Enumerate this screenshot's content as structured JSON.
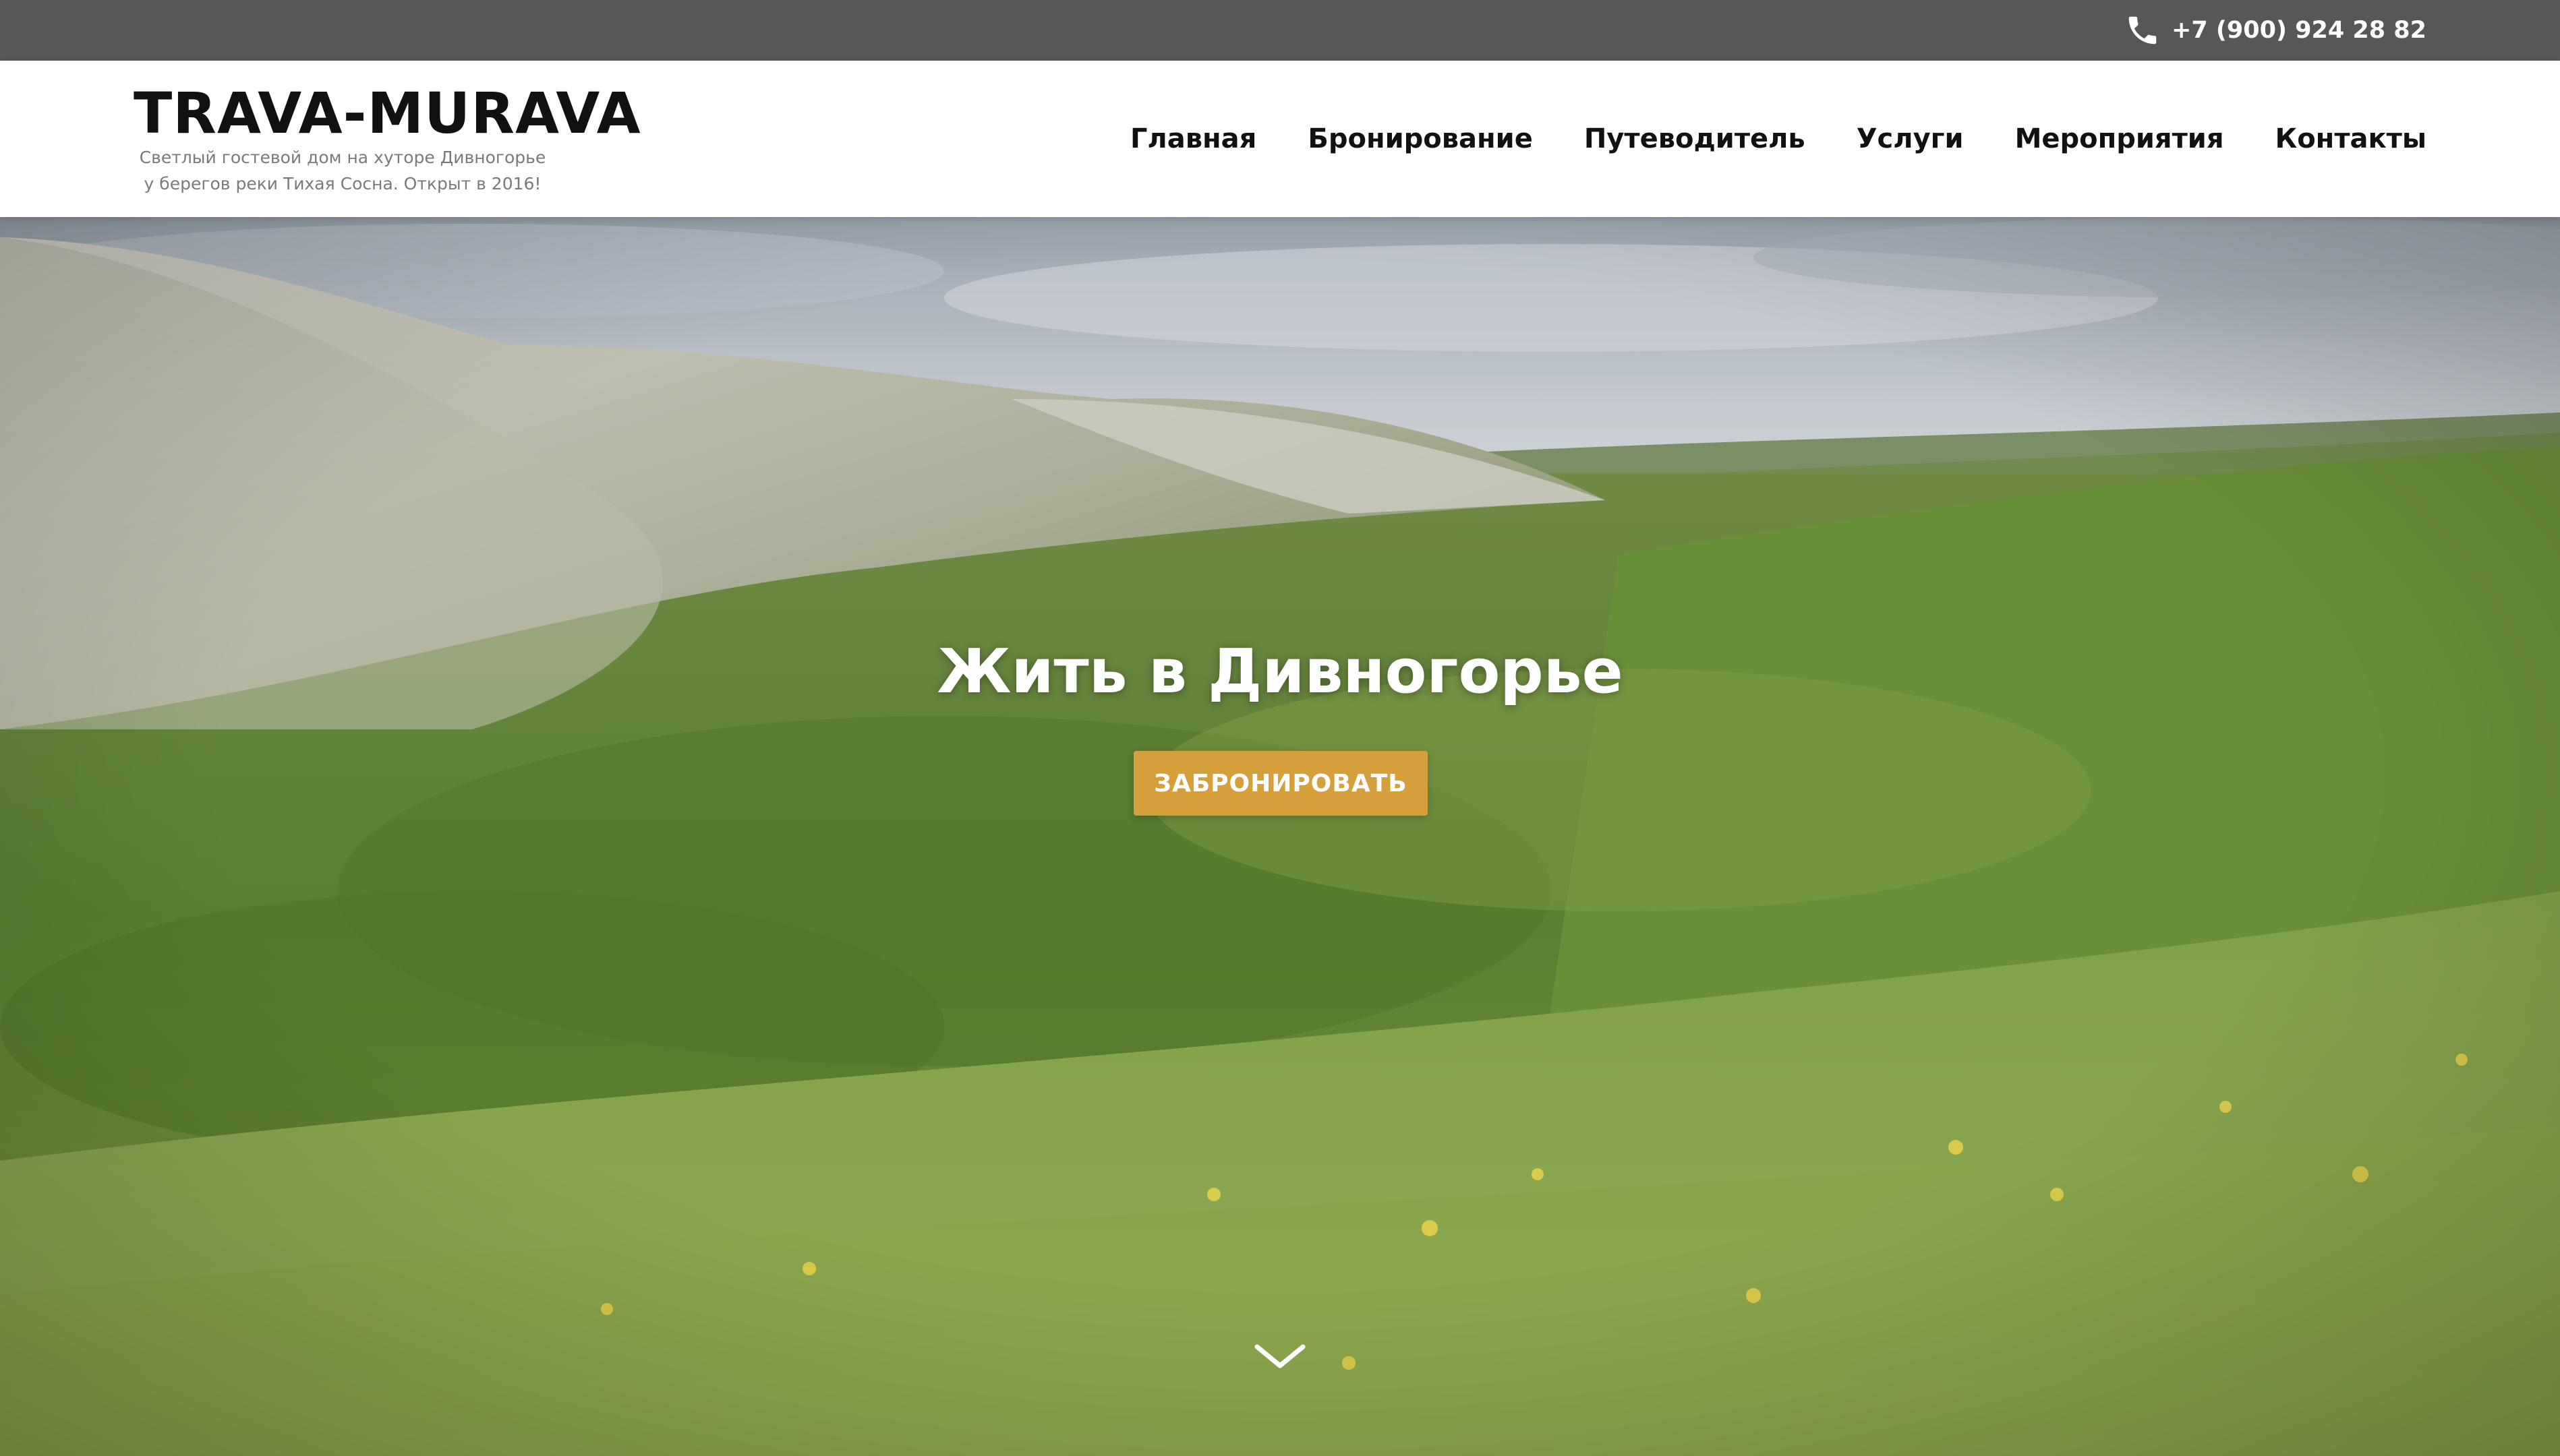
{
  "topbar": {
    "phone_icon": "phone-icon",
    "phone": "+7 (900) 924 28 82",
    "background": "#565759"
  },
  "header": {
    "brand_title": "TRAVA-MURAVA",
    "brand_sub_line1": "Светлый гостевой дом на хуторе Дивногорье",
    "brand_sub_line2": "у берегов реки Тихая Сосна. Открыт в 2016!"
  },
  "nav": {
    "items": [
      {
        "label": "Главная"
      },
      {
        "label": "Бронирование"
      },
      {
        "label": "Путеводитель"
      },
      {
        "label": "Услуги"
      },
      {
        "label": "Мероприятия"
      },
      {
        "label": "Контакты"
      }
    ]
  },
  "hero": {
    "title": "Жить в Дивногорье",
    "button_label": "ЗАБРОНИРОВАТЬ",
    "button_color": "#d5a03c",
    "scroll_icon": "chevron-down-icon"
  }
}
